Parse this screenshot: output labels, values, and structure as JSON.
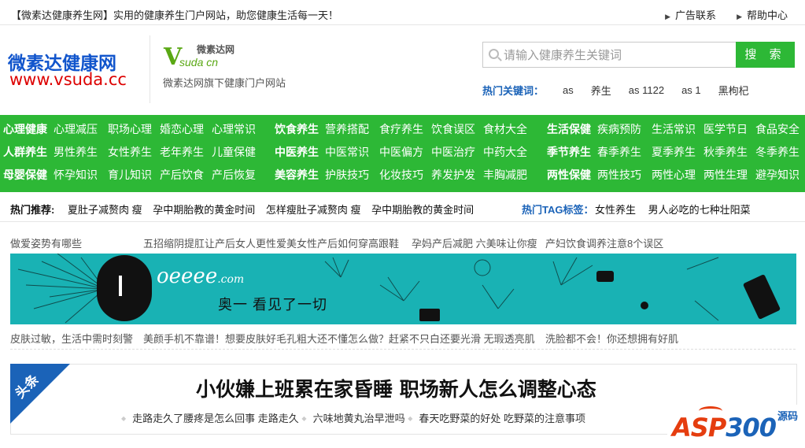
{
  "topbar": {
    "welcome": "【微素达健康养生网】实用的健康养生门户网站，助您健康生活每一天！",
    "links": [
      "广告联系",
      "帮助中心"
    ]
  },
  "header": {
    "logo_cn": "微素达健康网",
    "logo_url": "www.vsuda.cc",
    "brand_small": "微素达网",
    "brand_v": "V",
    "brand_sub": "suda cn",
    "brand_tagline": "微素达网旗下健康门户网站",
    "search_placeholder": "请输入健康养生关键词",
    "search_button": "搜 索",
    "hot_keywords_label": "热门关键词：",
    "hot_keywords": [
      "as",
      "养生",
      "as 1122",
      "as 1",
      "黑枸杞"
    ]
  },
  "nav": {
    "rows": [
      [
        {
          "head": "心理健康",
          "items": [
            "心理减压",
            "职场心理",
            "婚恋心理",
            "心理常识"
          ]
        },
        {
          "head": "饮食养生",
          "items": [
            "营养搭配",
            "食疗养生",
            "饮食误区",
            "食材大全"
          ]
        },
        {
          "head": "生活保健",
          "items": [
            "疾病预防",
            "生活常识",
            "医学节日",
            "食品安全"
          ]
        }
      ],
      [
        {
          "head": "人群养生",
          "items": [
            "男性养生",
            "女性养生",
            "老年养生",
            "儿童保健"
          ]
        },
        {
          "head": "中医养生",
          "items": [
            "中医常识",
            "中医偏方",
            "中医治疗",
            "中药大全"
          ]
        },
        {
          "head": "季节养生",
          "items": [
            "春季养生",
            "夏季养生",
            "秋季养生",
            "冬季养生"
          ]
        }
      ],
      [
        {
          "head": "母婴保健",
          "items": [
            "怀孕知识",
            "育儿知识",
            "产后饮食",
            "产后恢复"
          ]
        },
        {
          "head": "美容养生",
          "items": [
            "护肤技巧",
            "化妆技巧",
            "养发护发",
            "丰胸减肥"
          ]
        },
        {
          "head": "两性保健",
          "items": [
            "两性技巧",
            "两性心理",
            "两性生理",
            "避孕知识"
          ]
        }
      ]
    ]
  },
  "hot": {
    "label": "热门推荐:",
    "items": [
      "夏肚子减赘肉 瘦",
      "孕中期胎教的黄金时间",
      "怎样瘦肚子减赘肉 瘦",
      "孕中期胎教的黄金时间"
    ],
    "tag_label": "热门TAG标签：",
    "tags": [
      "女性养生",
      "男人必吃的七种壮阳菜"
    ]
  },
  "link_rows": {
    "row1": [
      "做爱姿势有哪些",
      "五招缩阴提肛让产后女人更性爱美女性产后如何穿高跟鞋",
      "孕妈产后减肥 六美味让你瘦",
      "产妇饮食调养注意8个误区"
    ],
    "row2": [
      "皮肤过敏，生活中需时刻警",
      "美颜手机不靠谱！想要皮肤好毛孔粗大还不懂怎么做？赶紧不只白还要光滑 无瑕透亮肌",
      "洗脸都不会！你还想拥有好肌"
    ]
  },
  "banner": {
    "logo": "oeeee",
    "logo_suffix": ".com",
    "slogan": "奥一 看见了一切",
    "bg_color": "#19b2b4"
  },
  "headline": {
    "ribbon": "头条",
    "title": "小伙嫌上班累在家昏睡 职场新人怎么调整心态",
    "subs": [
      "走路走久了腰疼是怎么回事 走路走久",
      "六味地黄丸治早泄吗",
      "春天吃野菜的好处 吃野菜的注意事项"
    ]
  },
  "watermark": {
    "asp": "ASP",
    "num": "300",
    "mark": "源码"
  },
  "colors": {
    "green": "#2db836",
    "blue": "#1b63b8",
    "red": "#dd0000"
  }
}
